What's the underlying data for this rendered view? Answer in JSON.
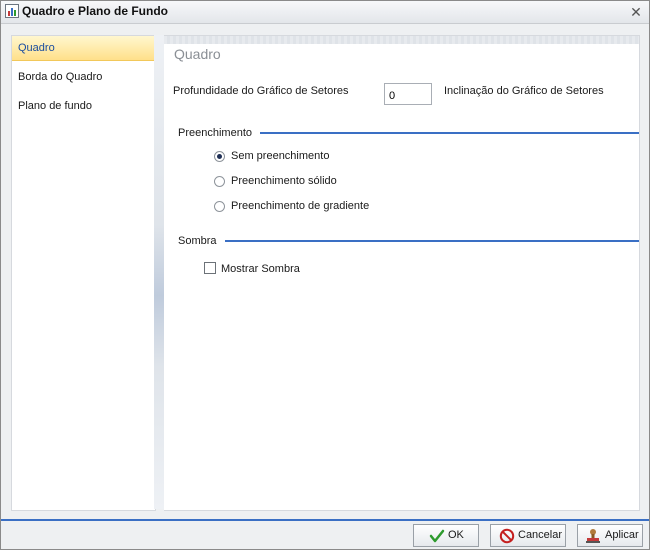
{
  "window": {
    "title": "Quadro e Plano de Fundo",
    "close_glyph": "✕"
  },
  "sidebar": {
    "items": [
      {
        "label": "Quadro",
        "active": true
      },
      {
        "label": "Borda do Quadro",
        "active": false
      },
      {
        "label": "Plano de fundo",
        "active": false
      }
    ]
  },
  "content": {
    "heading": "Quadro",
    "depth_label": "Profundidade do Gráfico de Setores",
    "depth_value": "0",
    "tilt_label": "Inclinação do Gráfico de Setores",
    "fill_section": "Preenchimento",
    "fill_options": [
      {
        "label": "Sem preenchimento",
        "checked": true
      },
      {
        "label": "Preenchimento sólido",
        "checked": false
      },
      {
        "label": "Preenchimento de gradiente",
        "checked": false
      }
    ],
    "shadow_section": "Sombra",
    "shadow_label": "Mostrar Sombra",
    "shadow_checked": false
  },
  "footer": {
    "ok": "OK",
    "cancel": "Cancelar",
    "apply": "Aplicar"
  },
  "colors": {
    "accent": "#3a6fc4",
    "selection": "#ffe08a",
    "ok_check": "#2e9b2e",
    "cancel_red": "#c41f1f"
  }
}
